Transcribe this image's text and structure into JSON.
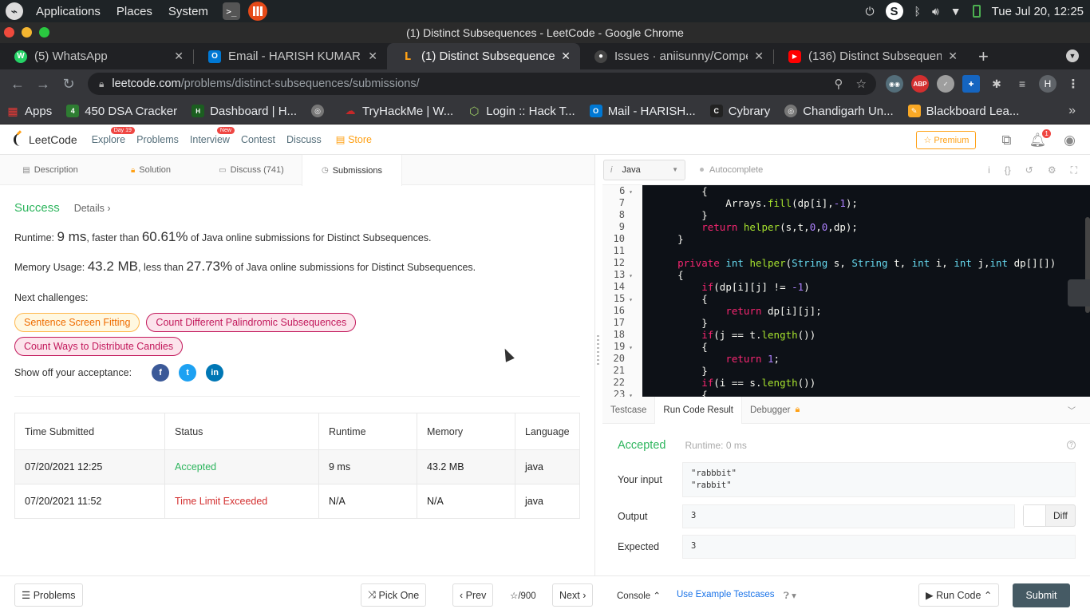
{
  "os": {
    "menus": [
      "Applications",
      "Places",
      "System"
    ],
    "clock": "Tue Jul 20, 12:25"
  },
  "window": {
    "title": "(1) Distinct Subsequences - LeetCode - Google Chrome"
  },
  "tabs": [
    {
      "title": "(5) WhatsApp",
      "color": "#25d366",
      "glyph": "W"
    },
    {
      "title": "Email - HARISH KUMAR -",
      "color": "#0078d4",
      "glyph": "O"
    },
    {
      "title": "(1) Distinct Subsequences",
      "color": "#ffa116",
      "glyph": "L",
      "active": true
    },
    {
      "title": "Issues · aniisunny/Compet",
      "color": "#444",
      "glyph": "G"
    },
    {
      "title": "(136) Distinct Subsequenc",
      "color": "#ff0000",
      "glyph": "▶"
    }
  ],
  "address": {
    "host": "leetcode.com",
    "path": "/problems/distinct-subsequences/submissions/"
  },
  "profile_initial": "H",
  "bookmarks": [
    {
      "label": "Apps",
      "color": "#e53935",
      "glyph": "▦"
    },
    {
      "label": "450 DSA Cracker",
      "color": "#2e7d32",
      "glyph": "4"
    },
    {
      "label": "Dashboard | H...",
      "color": "#1b5e20",
      "glyph": "H"
    },
    {
      "label": "",
      "color": "#777",
      "glyph": "◎"
    },
    {
      "label": "TryHackMe | W...",
      "color": "#c62828",
      "glyph": "☁"
    },
    {
      "label": "Login :: Hack T...",
      "color": "#9ccc65",
      "glyph": "⬡"
    },
    {
      "label": "Mail - HARISH...",
      "color": "#0078d4",
      "glyph": "O"
    },
    {
      "label": "Cybrary",
      "color": "#222",
      "glyph": "C"
    },
    {
      "label": "Chandigarh Un...",
      "color": "#777",
      "glyph": "◎"
    },
    {
      "label": "Blackboard Lea...",
      "color": "#f9a825",
      "glyph": "✎"
    }
  ],
  "lc_nav": {
    "logo": "LeetCode",
    "links": [
      {
        "label": "Explore",
        "badge": "Day 19"
      },
      {
        "label": "Problems",
        "badge": ""
      },
      {
        "label": "Interview",
        "badge": "New"
      },
      {
        "label": "Contest",
        "badge": ""
      },
      {
        "label": "Discuss",
        "badge": ""
      }
    ],
    "store": "Store",
    "premium": "Premium",
    "notif_count": "1"
  },
  "left_tabs": [
    {
      "label": "Description",
      "icon": "▤"
    },
    {
      "label": "Solution",
      "icon": "🔒"
    },
    {
      "label": "Discuss (741)",
      "icon": "▭"
    },
    {
      "label": "Submissions",
      "icon": "◷"
    }
  ],
  "result": {
    "status": "Success",
    "details": "Details",
    "runtime_prefix": "Runtime: ",
    "runtime_value": "9 ms",
    "runtime_mid": ", faster than ",
    "runtime_pct": "60.61%",
    "runtime_suffix": " of Java online submissions for Distinct Subsequences.",
    "memory_prefix": "Memory Usage: ",
    "memory_value": "43.2 MB",
    "memory_mid": ", less than ",
    "memory_pct": "27.73%",
    "memory_suffix": " of Java online submissions for Distinct Subsequences.",
    "next_label": "Next challenges:",
    "challenges": [
      {
        "label": "Sentence Screen Fitting",
        "level": "med"
      },
      {
        "label": "Count Different Palindromic Subsequences",
        "level": "hard"
      },
      {
        "label": "Count Ways to Distribute Candies",
        "level": "hard"
      }
    ],
    "share_label": "Show off your acceptance:",
    "share": [
      {
        "label": "f",
        "color": "#3b5998"
      },
      {
        "label": "t",
        "color": "#1da1f2"
      },
      {
        "label": "in",
        "color": "#0077b5"
      }
    ]
  },
  "table": {
    "headers": [
      "Time Submitted",
      "Status",
      "Runtime",
      "Memory",
      "Language"
    ],
    "rows": [
      [
        "07/20/2021 12:25",
        "Accepted",
        "9 ms",
        "43.2 MB",
        "java"
      ],
      [
        "07/20/2021 11:52",
        "Time Limit Exceeded",
        "N/A",
        "N/A",
        "java"
      ]
    ]
  },
  "editor": {
    "language": "Java",
    "autocomplete": "Autocomplete",
    "lines": [
      {
        "n": "6",
        "fold": true,
        "code": "        {"
      },
      {
        "n": "7",
        "fold": false,
        "code": "            Arrays.fill(dp[i],-1);"
      },
      {
        "n": "8",
        "fold": false,
        "code": "        }"
      },
      {
        "n": "9",
        "fold": false,
        "code": "        return helper(s,t,0,0,dp);"
      },
      {
        "n": "10",
        "fold": false,
        "code": "    }"
      },
      {
        "n": "11",
        "fold": false,
        "code": ""
      },
      {
        "n": "12",
        "fold": false,
        "code": "    private int helper(String s, String t, int i, int j,int dp[][])"
      },
      {
        "n": "13",
        "fold": true,
        "code": "    {"
      },
      {
        "n": "14",
        "fold": false,
        "code": "        if(dp[i][j] != -1)"
      },
      {
        "n": "15",
        "fold": true,
        "code": "        {"
      },
      {
        "n": "16",
        "fold": false,
        "code": "            return dp[i][j];"
      },
      {
        "n": "17",
        "fold": false,
        "code": "        }"
      },
      {
        "n": "18",
        "fold": false,
        "code": "        if(j == t.length())"
      },
      {
        "n": "19",
        "fold": true,
        "code": "        {"
      },
      {
        "n": "20",
        "fold": false,
        "code": "            return 1;"
      },
      {
        "n": "21",
        "fold": false,
        "code": "        }"
      },
      {
        "n": "22",
        "fold": false,
        "code": "        if(i == s.length())"
      },
      {
        "n": "23",
        "fold": true,
        "code": "        {"
      }
    ]
  },
  "run_tabs": [
    "Testcase",
    "Run Code Result",
    "Debugger"
  ],
  "run_result": {
    "status": "Accepted",
    "runtime": "Runtime: 0 ms",
    "input_label": "Your input",
    "input_lines": [
      "\"rabbbit\"",
      "\"rabbit\""
    ],
    "output_label": "Output",
    "output": "3",
    "expected_label": "Expected",
    "expected": "3",
    "diff": "Diff"
  },
  "bottom": {
    "problems": "Problems",
    "pick_one": "Pick One",
    "prev": "Prev",
    "page": "/900",
    "next": "Next",
    "console": "Console",
    "use_example": "Use Example Testcases",
    "run_code": "Run Code",
    "submit": "Submit"
  }
}
